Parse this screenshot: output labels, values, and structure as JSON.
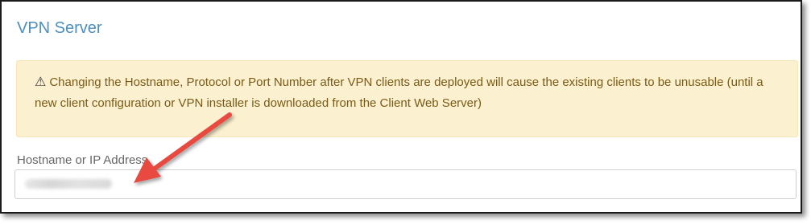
{
  "panel": {
    "title": "VPN Server"
  },
  "alert": {
    "icon": "warning-icon",
    "icon_glyph": "⚠",
    "message": "Changing the Hostname, Protocol or Port Number after VPN clients are deployed will cause the existing clients to be unusable (until a new client configuration or VPN installer is downloaded from the Client Web Server)"
  },
  "hostname_field": {
    "label": "Hostname or IP Address",
    "value": ""
  },
  "annotation": {
    "icon": "arrow-icon",
    "color": "#e8493f"
  },
  "colors": {
    "title": "#4e8fbf",
    "alert_background": "#fbf0cf",
    "alert_text": "#7a5b16"
  }
}
